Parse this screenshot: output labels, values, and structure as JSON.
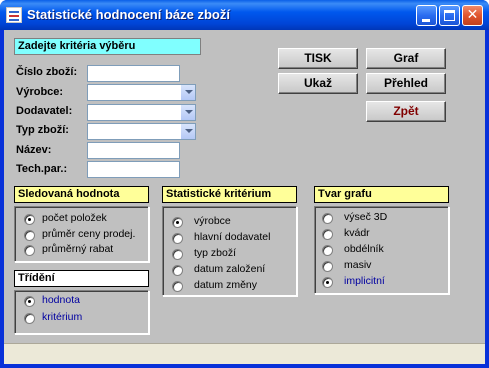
{
  "window": {
    "title": "Statistické hodnocení báze zboží"
  },
  "criteria": {
    "header": "Zadejte kritéria výběru",
    "fields": [
      {
        "label": "Číslo zboží:",
        "value": ""
      },
      {
        "label": "Výrobce:",
        "value": ""
      },
      {
        "label": "Dodavatel:",
        "value": ""
      },
      {
        "label": "Typ zboží:",
        "value": ""
      },
      {
        "label": "Název:",
        "value": ""
      },
      {
        "label": "Tech.par.:",
        "value": ""
      }
    ]
  },
  "buttons": {
    "tisk": "TISK",
    "graf": "Graf",
    "ukaz": "Ukaž",
    "prehled": "Přehled",
    "zpet": "Zpět"
  },
  "sledovana": {
    "header": "Sledovaná hodnota",
    "options": [
      "počet položek",
      "průměr ceny prodej.",
      "průměrný rabat"
    ],
    "selected": 0
  },
  "trideni": {
    "header": "Třídění",
    "options": [
      "hodnota",
      "kritérium"
    ],
    "selected": 0
  },
  "statisticke": {
    "header": "Statistické kritérium",
    "options": [
      "výrobce",
      "hlavní dodavatel",
      "typ zboží",
      "datum založení",
      "datum změny"
    ],
    "selected": 0
  },
  "tvar": {
    "header": "Tvar grafu",
    "options": [
      "výseč 3D",
      "kvádr",
      "obdélník",
      "masiv",
      "implicitní"
    ],
    "selected": 4
  },
  "colors": {
    "titlebar": "#0054e3",
    "client": "#c0c0c0",
    "header_cyan": "#80ffff",
    "header_yellow": "#ffff99",
    "option_blue": "#0000a0",
    "zpet_red": "#800000"
  }
}
